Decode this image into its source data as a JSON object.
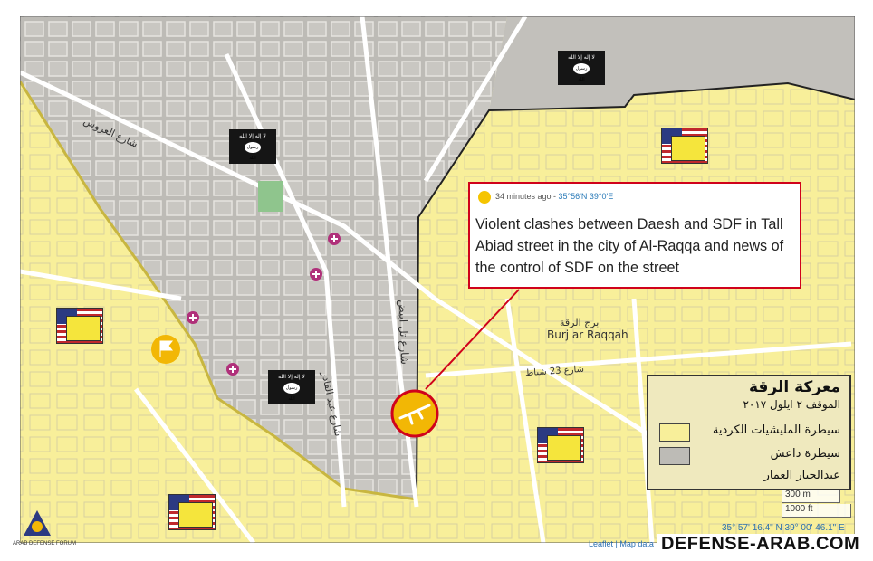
{
  "popup": {
    "time": "34 minutes ago",
    "coords": "35°56'N 39°0'E",
    "text": "Violent clashes between Daesh and SDF in Tall Abiad street in the city of Al-Raqqa and news of the control of SDF on the street"
  },
  "legend": {
    "title": "معركة الرقة",
    "date": "الموقف ٢ ايلول ٢٠١٧",
    "sdf_label": "سيطرة المليشيات الكردية",
    "isis_label": "سيطرة داعش",
    "author": "عبدالجبار العمار"
  },
  "colors": {
    "sdf": "#f8ef9a",
    "isis": "#bdbbb6",
    "border": "#c8b640",
    "accent": "#d0021b"
  },
  "map_labels": {
    "burj_ar": "برج الرقة",
    "burj_en": "Burj ar Raqqah",
    "street_23": "شارع 23 شباط",
    "street_tall_abiad": "شارع تل ابيض",
    "street_arous": "شارع العروس",
    "street_qaa": "شارع عبد القادر"
  },
  "isis_flag": {
    "line1": "لا إله إلا الله",
    "line2": "رسول الله"
  },
  "scale": {
    "metric": "300 m",
    "imperial": "1000 ft"
  },
  "cursor_coords": "35° 57' 16.4\" N 39° 00' 46.1\" E",
  "attribution": "Leaflet | Map data",
  "watermark": "DEFENSE-ARAB.COM",
  "forum": "ARAB DEFENSE FORUM",
  "icons": [
    "us-sdf-flag-icon",
    "isis-flag-icon",
    "rifle-icon",
    "hospital-icon",
    "flag-marker-icon"
  ]
}
